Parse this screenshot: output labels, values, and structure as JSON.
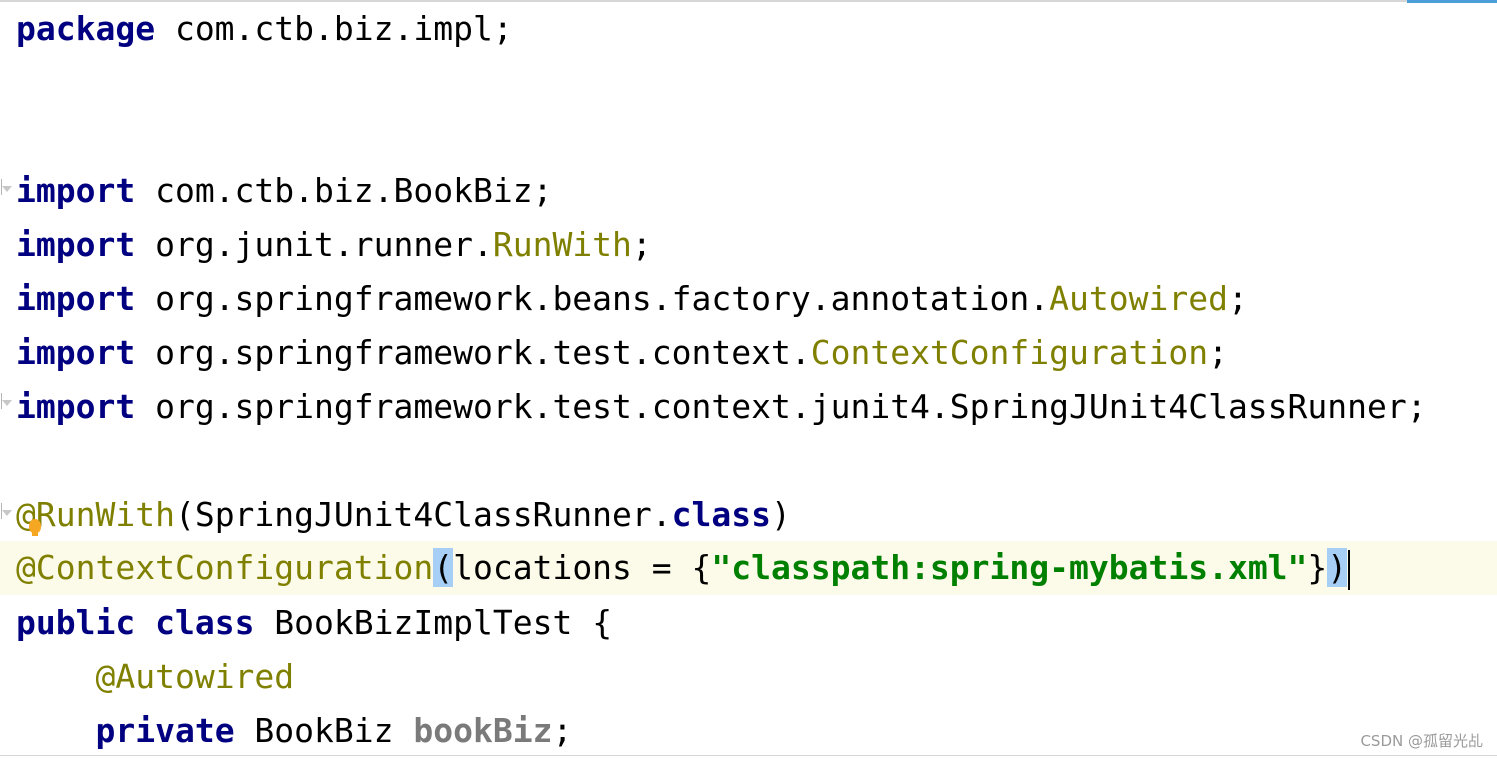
{
  "code": {
    "package_line": {
      "keyword": "package",
      "name": " com.ctb.biz.impl;"
    },
    "imports": [
      {
        "keyword": "import",
        "path": " com.ctb.biz.BookBiz;",
        "class": "",
        "end": ""
      },
      {
        "keyword": "import",
        "path": " org.junit.runner.",
        "class": "RunWith",
        "end": ";"
      },
      {
        "keyword": "import",
        "path": " org.springframework.beans.factory.annotation.",
        "class": "Autowired",
        "end": ";"
      },
      {
        "keyword": "import",
        "path": " org.springframework.test.context.",
        "class": "ContextConfiguration",
        "end": ";"
      },
      {
        "keyword": "import",
        "path": " org.springframework.test.context.junit4.SpringJUnit4ClassRunner;",
        "class": "",
        "end": ""
      }
    ],
    "runwith_line": {
      "at": "@",
      "annotation": "RunWith",
      "open": "(SpringJUnit4ClassRunner.",
      "keyword": "class",
      "close": ")"
    },
    "contextconfig_line": {
      "annotation": "@ContextConfiguration",
      "open_paren": "(",
      "middle": "locations = {",
      "string": "\"classpath:spring-mybatis.xml\"",
      "end_brace": "}",
      "close_paren": ")"
    },
    "class_line": {
      "kw1": "public",
      "kw2": "class",
      "name": " BookBizImplTest {"
    },
    "autowired_line": {
      "indent": "    ",
      "annotation": "@Autowired"
    },
    "field_line": {
      "indent": "    ",
      "keyword": "private",
      "type": " BookBiz ",
      "field": "bookBiz",
      "end": ";"
    }
  },
  "icons": {
    "gutter_folds": [
      "fold-marker-icon"
    ],
    "intention": "lightbulb-icon"
  },
  "colors": {
    "keyword": "#000080",
    "annotation": "#808000",
    "string": "#008000",
    "field": "#7a7a7a",
    "current_line": "#fcfae8",
    "brace_match": "#a7cef5"
  },
  "watermark": "CSDN @孤留光乩"
}
